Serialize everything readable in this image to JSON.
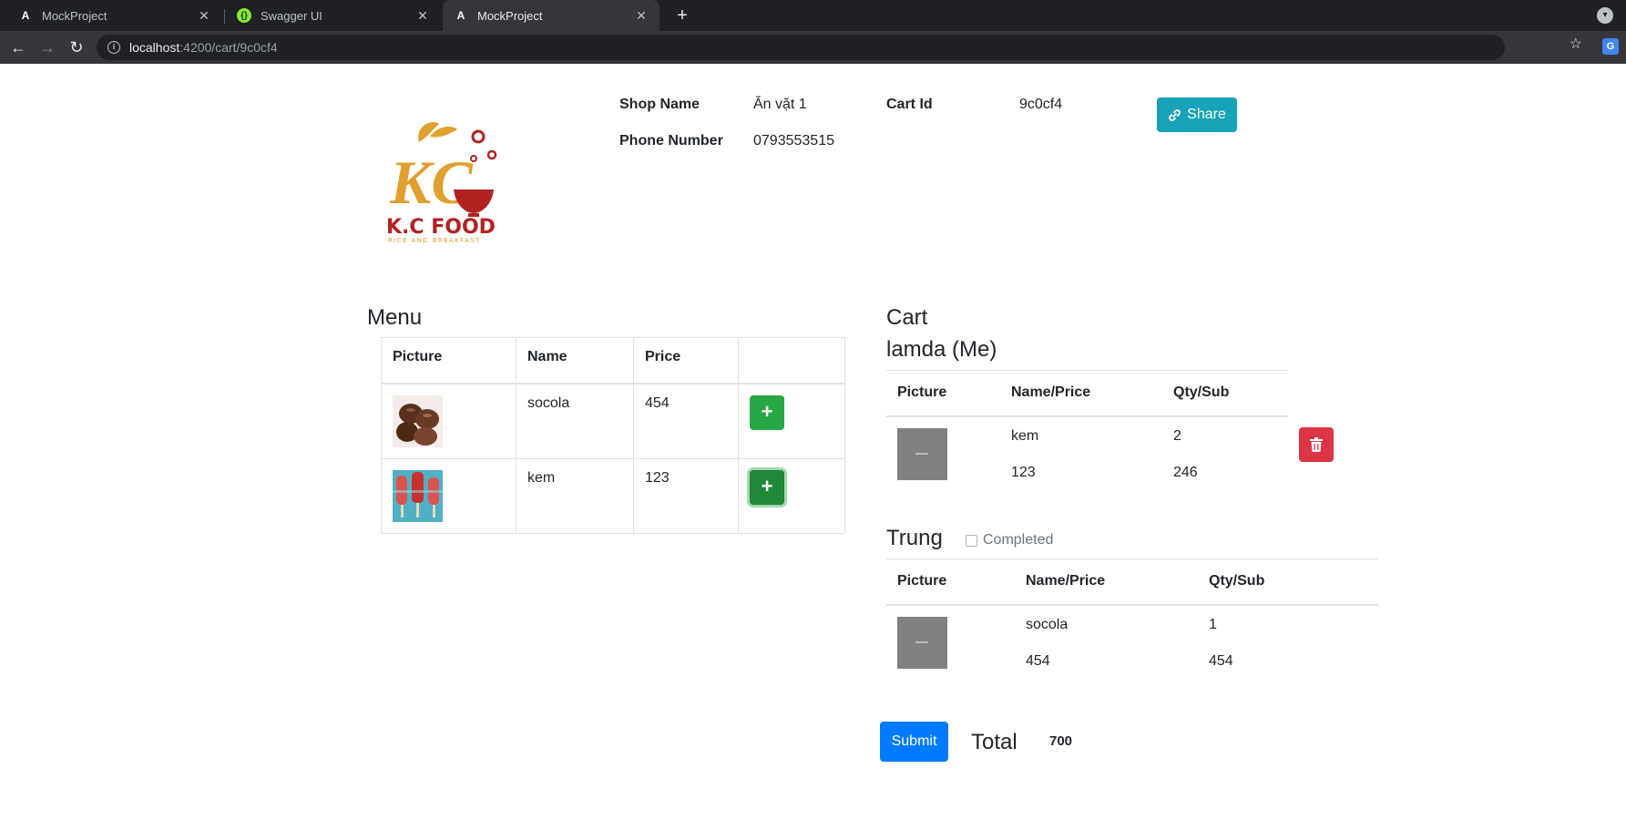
{
  "browser": {
    "tabs": [
      {
        "title": "MockProject",
        "favicon": "angular-icon"
      },
      {
        "title": "Swagger UI",
        "favicon": "swagger-icon"
      },
      {
        "title": "MockProject",
        "favicon": "angular-icon",
        "active": true
      }
    ],
    "url_host": "localhost",
    "url_path": ":4200/cart/9c0cf4"
  },
  "header": {
    "logo_text": "K.C FOOD",
    "logo_tagline": "RICE AND BREAKFAST",
    "shop_name_label": "Shop Name",
    "shop_name": "Ăn vặt 1",
    "phone_label": "Phone Number",
    "phone": "0793553515",
    "cart_id_label": "Cart Id",
    "cart_id": "9c0cf4",
    "share_label": "Share"
  },
  "menu": {
    "title": "Menu",
    "columns": [
      "Picture",
      "Name",
      "Price",
      ""
    ],
    "items": [
      {
        "name": "socola",
        "price": "454",
        "picture": "chocolate-image"
      },
      {
        "name": "kem",
        "price": "123",
        "picture": "popsicle-image"
      }
    ],
    "add_icon": "+"
  },
  "cart": {
    "title": "Cart",
    "groups": [
      {
        "person": "lamda (Me)",
        "columns": [
          "Picture",
          "Name/Price",
          "Qty/Sub"
        ],
        "rows": [
          {
            "name": "kem",
            "price": "123",
            "qty": "2",
            "sub": "246"
          }
        ]
      },
      {
        "person": "Trung",
        "completed_label": "Completed",
        "completed": false,
        "columns": [
          "Picture",
          "Name/Price",
          "Qty/Sub"
        ],
        "rows": [
          {
            "name": "socola",
            "price": "454",
            "qty": "1",
            "sub": "454"
          }
        ]
      }
    ]
  },
  "footer": {
    "submit_label": "Submit",
    "total_label": "Total",
    "total_value": "700"
  },
  "colors": {
    "share": "#17a2b8",
    "add": "#28a745",
    "delete": "#dc3545",
    "submit": "#007bff"
  }
}
